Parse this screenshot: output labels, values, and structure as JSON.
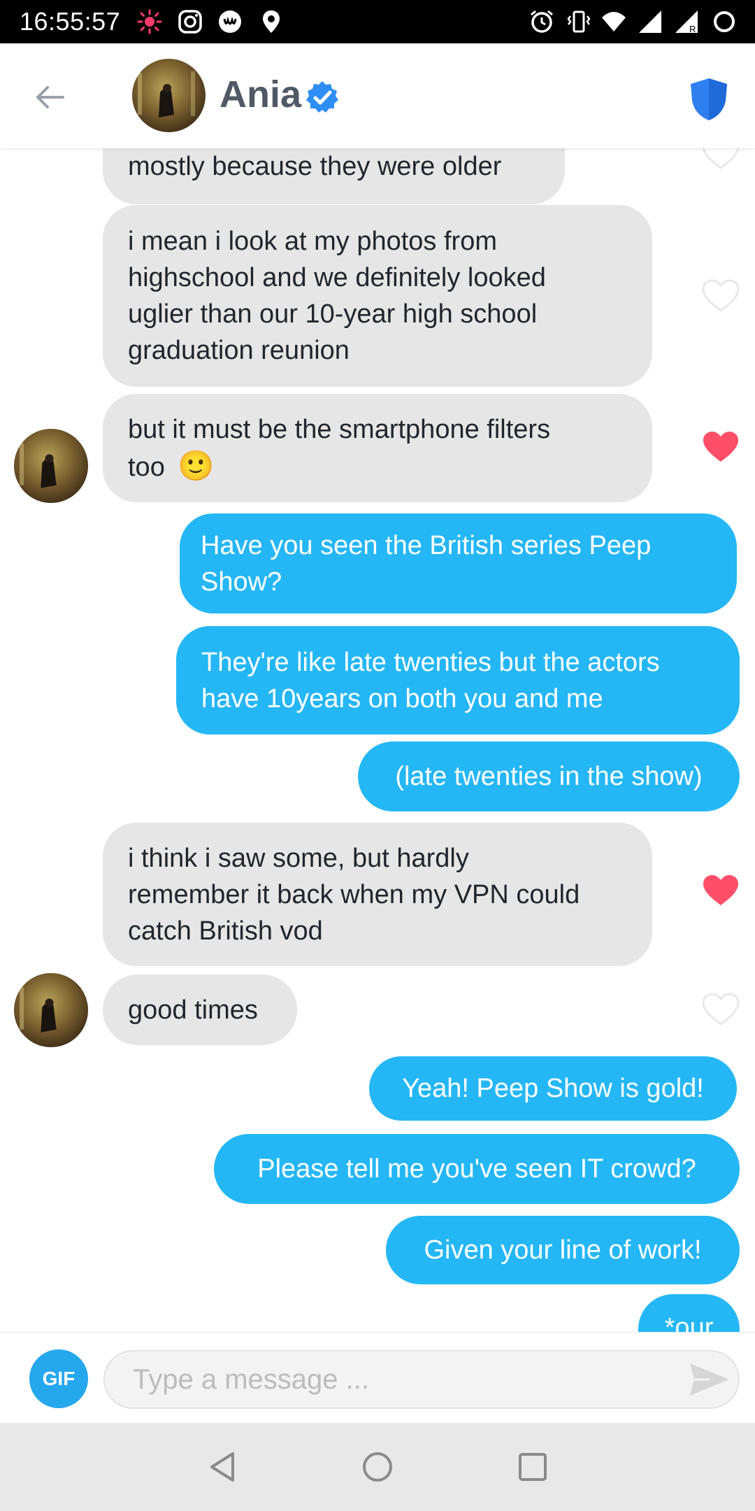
{
  "status_bar": {
    "time": "16:55:57",
    "icons": [
      "sun-notification-icon",
      "instagram-icon",
      "app-notification-icon",
      "location-icon",
      "alarm-icon",
      "vibrate-icon",
      "wifi-icon",
      "signal-icon",
      "signal-roaming-icon",
      "battery-icon"
    ]
  },
  "header": {
    "name": "Ania",
    "verified": true,
    "icons": [
      "back-arrow-icon",
      "verified-badge-icon",
      "safety-shield-icon"
    ]
  },
  "messages": [
    {
      "from": "them",
      "text": "mostly because they were older",
      "liked": false
    },
    {
      "from": "them",
      "lines": [
        "i mean i look at my photos from",
        "highschool and we definitely looked",
        "uglier than our 10-year high school",
        "graduation reunion"
      ],
      "liked": false
    },
    {
      "from": "them",
      "lines": [
        "but it must be the smartphone filters",
        "too"
      ],
      "emoji": "🙂",
      "liked": true
    },
    {
      "from": "me",
      "lines": [
        "Have you seen the British series Peep",
        "Show?"
      ]
    },
    {
      "from": "me",
      "lines": [
        "They're like late twenties but the actors",
        "have 10years on both you and me"
      ]
    },
    {
      "from": "me",
      "text": "(late twenties in the show)"
    },
    {
      "from": "them",
      "lines": [
        "i think i saw some, but hardly",
        "remember it back when my VPN could",
        "catch British vod"
      ],
      "liked": true
    },
    {
      "from": "them",
      "text": "good times",
      "liked": false
    },
    {
      "from": "me",
      "text": "Yeah! Peep Show is gold!"
    },
    {
      "from": "me",
      "text": "Please tell me you've seen IT crowd?"
    },
    {
      "from": "me",
      "text": "Given your line of work!"
    },
    {
      "from": "me",
      "text": "*our"
    }
  ],
  "composer": {
    "gif_label": "GIF",
    "placeholder": "Type a message ..."
  },
  "nav": [
    "back-triangle-icon",
    "home-circle-icon",
    "recents-square-icon"
  ],
  "colors": {
    "outgoing": "#25b7f5",
    "incoming": "#e6e6e6",
    "heart": "#fd5068",
    "verified": "#2e8ef5"
  }
}
